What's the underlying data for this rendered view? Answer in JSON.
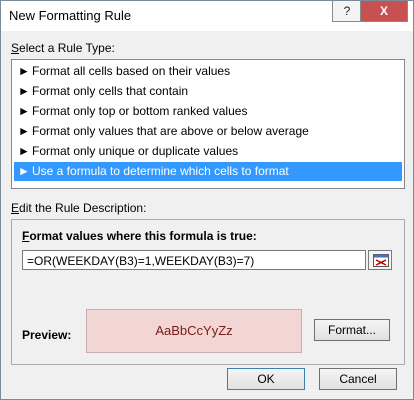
{
  "window": {
    "title": "New Formatting Rule",
    "help_label": "?",
    "close_label": "X"
  },
  "rule_type": {
    "label_prefix": "S",
    "label_rest": "elect a Rule Type:",
    "items": [
      {
        "label": "Format all cells based on their values",
        "selected": false
      },
      {
        "label": "Format only cells that contain",
        "selected": false
      },
      {
        "label": "Format only top or bottom ranked values",
        "selected": false
      },
      {
        "label": "Format only values that are above or below average",
        "selected": false
      },
      {
        "label": "Format only unique or duplicate values",
        "selected": false
      },
      {
        "label": "Use a formula to determine which cells to format",
        "selected": true
      }
    ],
    "item_arrow": "►"
  },
  "description": {
    "label_prefix": "E",
    "label_rest": "dit the Rule Description:",
    "formula_label_prefix": "F",
    "formula_label_rest": "ormat values where this formula is true:",
    "formula_value": "=OR(WEEKDAY(B3)=1,WEEKDAY(B3)=7)",
    "preview_label": "Preview:",
    "preview_sample": "AaBbCcYyZz",
    "format_button": "Format..."
  },
  "buttons": {
    "ok": "OK",
    "cancel": "Cancel"
  },
  "colors": {
    "selection": "#3399ff",
    "preview_fill": "#f2d6d4",
    "close_button": "#c75050"
  }
}
